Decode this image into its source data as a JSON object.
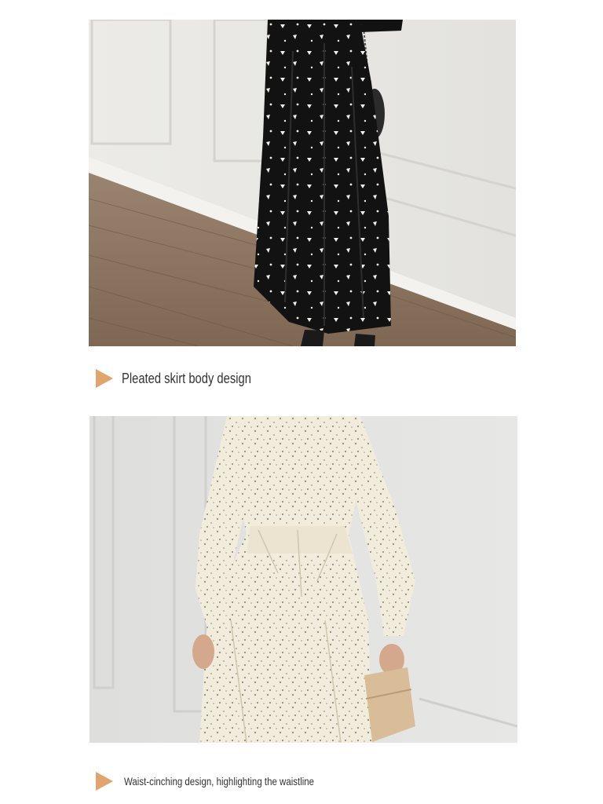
{
  "sections": [
    {
      "image": {
        "subject": "black-polka-dot-dress-skirt",
        "colors": {
          "wall": "#e9e8e4",
          "floor": "#8d7560",
          "dress": "#121212",
          "dots": "#f1efe8"
        }
      },
      "caption": "Pleated skirt body design",
      "marker_icon": "play-arrow-icon"
    },
    {
      "image": {
        "subject": "cream-floral-dress",
        "colors": {
          "wall": "#e3e3e1",
          "dress": "#f2ecdc",
          "print": "#8b8a78",
          "bag": "#d8bd98"
        }
      },
      "caption": "Waist-cinching design, highlighting the waistline",
      "marker_icon": "play-arrow-icon"
    }
  ],
  "accent_color": "#e0a56e"
}
